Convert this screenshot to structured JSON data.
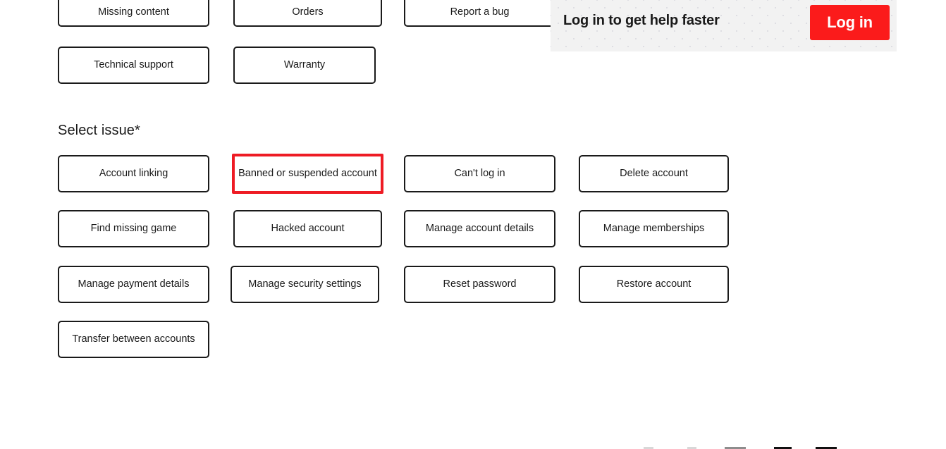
{
  "colors": {
    "accent_red": "#fb1b1b",
    "highlight_red": "#ee1b24",
    "banner_bg": "#f2f2f2",
    "button_border": "#1a1a1a",
    "text": "#1a1a1a"
  },
  "login_banner": {
    "message": "Log in to get help faster",
    "button_label": "Log in"
  },
  "category_section": {
    "buttons": [
      {
        "label": "Missing content"
      },
      {
        "label": "Orders"
      },
      {
        "label": "Report a bug"
      },
      {
        "label": "Technical support"
      },
      {
        "label": "Warranty"
      }
    ]
  },
  "issue_section": {
    "heading": "Select issue*",
    "buttons": [
      {
        "label": "Account linking",
        "selected": false
      },
      {
        "label": "Banned or suspended account",
        "selected": true
      },
      {
        "label": "Can't log in",
        "selected": false
      },
      {
        "label": "Delete account",
        "selected": false
      },
      {
        "label": "Find missing game",
        "selected": false
      },
      {
        "label": "Hacked account",
        "selected": false
      },
      {
        "label": "Manage account details",
        "selected": false
      },
      {
        "label": "Manage memberships",
        "selected": false
      },
      {
        "label": "Manage payment details",
        "selected": false
      },
      {
        "label": "Manage security settings",
        "selected": false
      },
      {
        "label": "Reset password",
        "selected": false
      },
      {
        "label": "Restore account",
        "selected": false
      },
      {
        "label": "Transfer between accounts",
        "selected": false
      }
    ]
  }
}
